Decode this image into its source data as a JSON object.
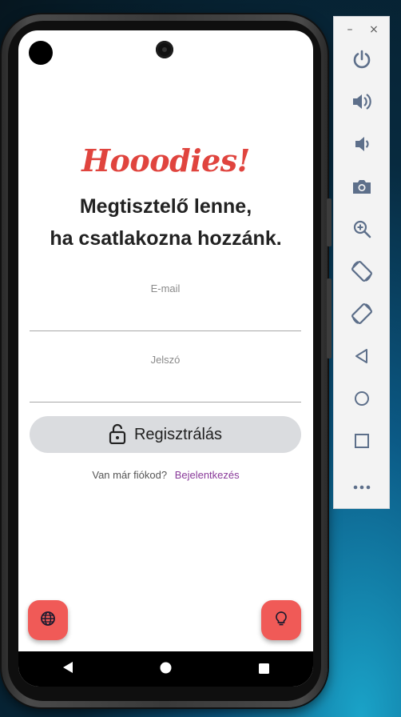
{
  "app": {
    "logo_text": "Hooodies!",
    "headline_line1": "Megtisztelő lenne,",
    "headline_line2": "ha csatlakozna hozzánk."
  },
  "form": {
    "email_label": "E-mail",
    "email_value": "",
    "password_label": "Jelszó",
    "password_value": "",
    "register_button_label": "Regisztrálás",
    "login_prompt": "Van már fiókod?",
    "login_link": "Bejelentkezés"
  },
  "fabs": {
    "left_icon": "globe-icon",
    "right_icon": "lightbulb-icon"
  },
  "nav": {
    "back_icon": "back-triangle-icon",
    "home_icon": "home-circle-icon",
    "recents_icon": "recents-square-icon"
  },
  "emulator_toolbar": {
    "minimize_glyph": "–",
    "close_glyph": "×",
    "items": [
      "power-icon",
      "volume-up-icon",
      "volume-down-icon",
      "camera-icon",
      "zoom-icon",
      "rotate-left-icon",
      "rotate-right-icon",
      "back-icon",
      "home-icon",
      "overview-icon",
      "more-icon"
    ]
  },
  "colors": {
    "brand": "#e0443e",
    "fab": "#f05a57",
    "link": "#8a3b9a",
    "button_bg": "#dadcdf"
  }
}
